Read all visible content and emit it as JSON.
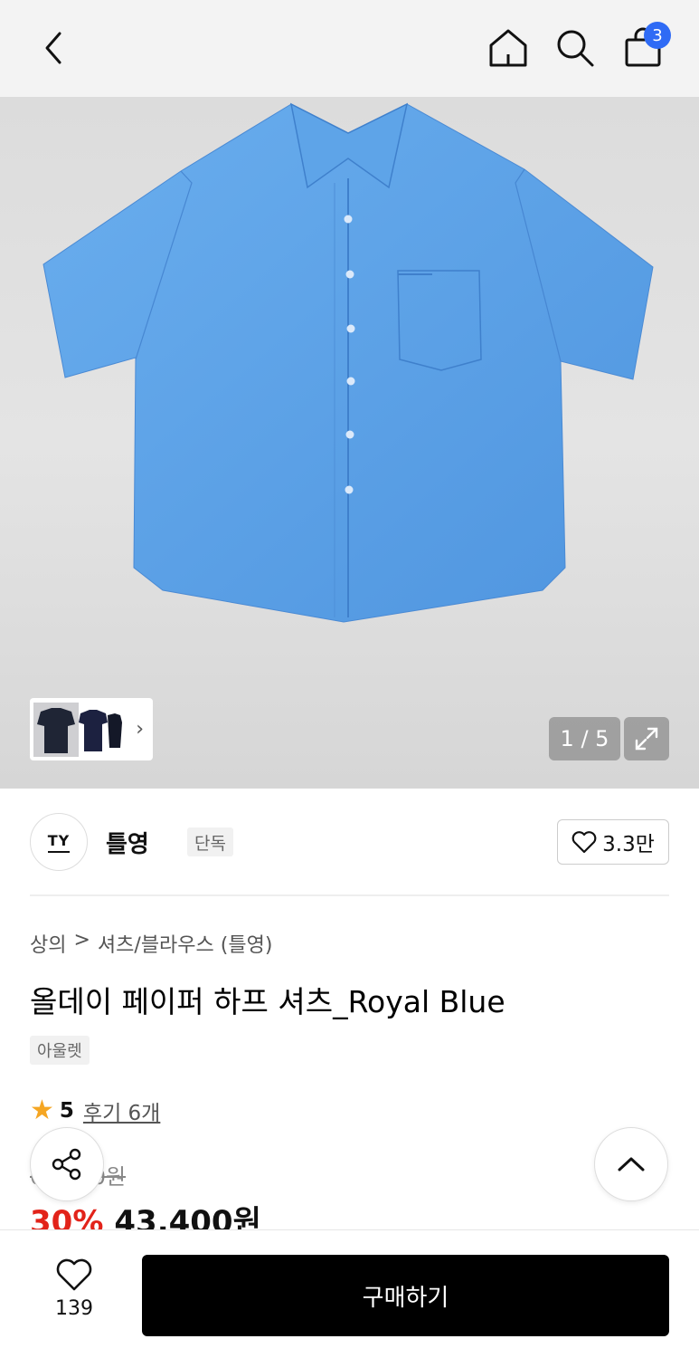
{
  "header": {
    "cart_count": "3",
    "icons": [
      "back-icon",
      "home-icon",
      "search-icon",
      "shopping-bag-icon"
    ]
  },
  "gallery": {
    "counter": "1 / 5",
    "shirt_color": "#5ea4e8"
  },
  "brand": {
    "logo_text": "TY",
    "name": "틀영",
    "badge": "단독",
    "likes": "3.3만"
  },
  "product": {
    "breadcrumb": [
      "상의",
      ">",
      "셔츠/블라우스 (틀영)"
    ],
    "title": "올데이 페이퍼 하프 셔츠_Royal Blue",
    "tag": "아울렛",
    "rating": "5",
    "reviews": "후기 6개",
    "original_price": "62,000원",
    "discount": "30%",
    "sale_price": "43,400원"
  },
  "bottom": {
    "wish_count": "139",
    "buy_label": "구매하기"
  },
  "colors": {
    "accent_blue": "#2f6bf5",
    "discount_red": "#e2231a",
    "star": "#f5a623"
  }
}
